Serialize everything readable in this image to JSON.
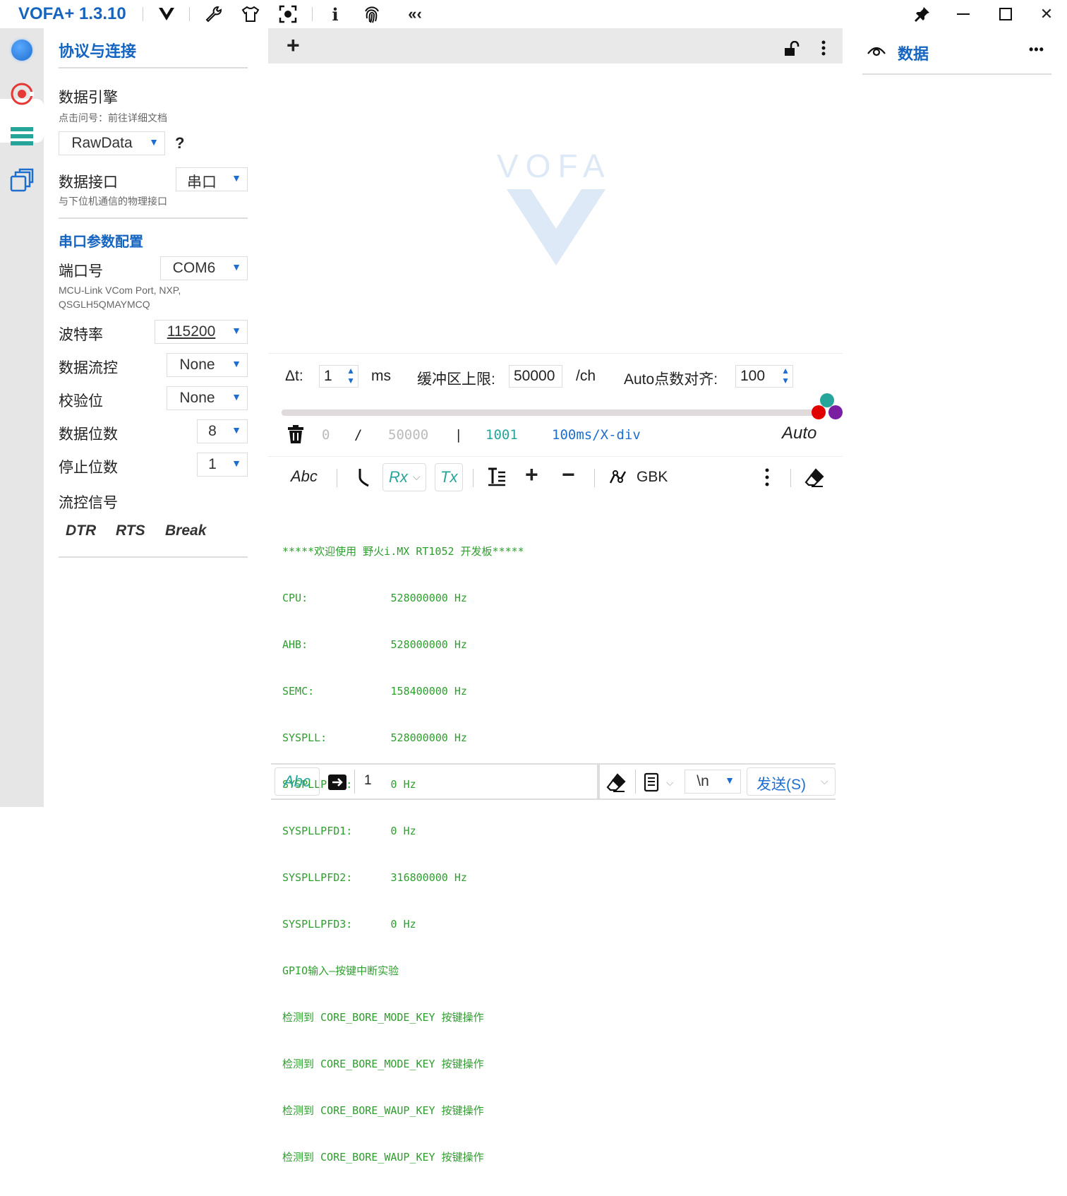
{
  "titlebar": {
    "app_title": "VOFA+ 1.3.10",
    "icons": [
      "vofa-logo-icon",
      "wrench-icon",
      "shirt-icon",
      "screenshot-icon",
      "info-icon",
      "fingerprint-icon",
      "collapse-icon"
    ],
    "pin_icon": "pin-icon",
    "min_icon": "minimize-icon",
    "max_icon": "maximize-icon",
    "close_icon": "close-icon"
  },
  "rail": {
    "items": [
      "status-dot-icon",
      "record-icon",
      "list-icon",
      "windows-icon"
    ],
    "accent": "#1e88e5",
    "record_color": "#e53935",
    "list_color": "#26a69a"
  },
  "left_panel": {
    "title": "协议与连接",
    "engine_label": "数据引擎",
    "engine_hint": "点击问号：前往详细文档",
    "engine_value": "RawData",
    "help": "?",
    "interface_label": "数据接口",
    "interface_value": "串口",
    "interface_hint": "与下位机通信的物理接口",
    "serial_title": "串口参数配置",
    "port_label": "端口号",
    "port_value": "COM6",
    "port_hint_1": "MCU-Link VCom Port, NXP,",
    "port_hint_2": "QSGLH5QMAYMCQ",
    "baud_label": "波特率",
    "baud_value": "115200",
    "flow_label": "数据流控",
    "flow_value": "None",
    "parity_label": "校验位",
    "parity_value": "None",
    "databits_label": "数据位数",
    "databits_value": "8",
    "stopbits_label": "停止位数",
    "stopbits_value": "1",
    "signals_label": "流控信号",
    "dtr": "DTR",
    "rts": "RTS",
    "break": "Break"
  },
  "center": {
    "add": "+",
    "watermark": "VOFA",
    "dt_label": "Δt:",
    "dt_value": "1",
    "ms": "ms",
    "buffer_label": "缓冲区上限:",
    "buffer_value": "50000",
    "per_ch": "/ch",
    "auto_label": "Auto点数对齐:",
    "auto_value": "100",
    "stat_start": "0",
    "stat_slash": "/",
    "stat_total": "50000",
    "stat_bar": "|",
    "stat_points": "1001",
    "stat_div": "100ms/X-div",
    "stat_auto": "Auto",
    "tb_abc": "Abc",
    "tb_rx": "Rx",
    "tb_tx": "Tx",
    "tb_plus": "+",
    "tb_minus": "−",
    "tb_gbk": "GBK",
    "console": [
      "*****欢迎使用 野火i.MX RT1052 开发板*****",
      "CPU:             528000000 Hz",
      "AHB:             528000000 Hz",
      "SEMC:            158400000 Hz",
      "SYSPLL:          528000000 Hz",
      "SYSPLLPFD0:      0 Hz",
      "SYSPLLPFD1:      0 Hz",
      "SYSPLLPFD2:      316800000 Hz",
      "SYSPLLPFD3:      0 Hz",
      "GPIO输入—按键中断实验",
      "检测到 CORE_BORE_MODE_KEY 按键操作",
      "检测到 CORE_BORE_MODE_KEY 按键操作",
      "检测到 CORE_BORE_WAUP_KEY 按键操作",
      "检测到 CORE_BORE_WAUP_KEY 按键操作"
    ],
    "send_abc": "Abc",
    "send_input": "1",
    "newline_value": "\\n",
    "send_label": "发送(S)",
    "console_color": "#2e9e2e",
    "teal": "#26a69a"
  },
  "right_panel": {
    "title": "数据",
    "more": "•••"
  }
}
